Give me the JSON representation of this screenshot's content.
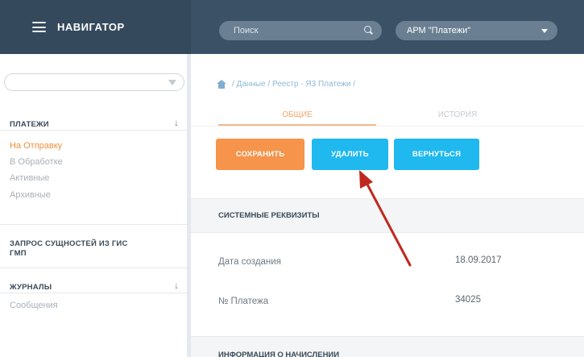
{
  "header": {
    "nav_title": "НАВИГАТОР",
    "search_placeholder": "Поиск",
    "arm_select": "АРМ \"Платежи\""
  },
  "sidebar": {
    "filter_placeholder": "",
    "sections": [
      {
        "title": "ПЛАТЕЖИ",
        "items": [
          "На Отправку",
          "В Обработке",
          "Активные",
          "Архивные"
        ],
        "active_item": "На Отправку"
      },
      {
        "title_line1": "ЗАПРОС СУЩНОСТЕЙ ИЗ ГИС",
        "title_line2": "ГМП"
      },
      {
        "title": "ЖУРНАЛЫ",
        "items": [
          "Сообщения"
        ]
      }
    ],
    "expand_arrow": "↓"
  },
  "main": {
    "breadcrumb": "/ Данные / Реестр - Я3 Платежи /",
    "tabs": {
      "general": "ОБЩИЕ",
      "history": "ИСТОРИЯ"
    },
    "buttons": {
      "save": "СОХРАНИТЬ",
      "delete": "УДАЛИТЬ",
      "back": "ВЕРНУТЬСЯ"
    },
    "section_title": "СИСТЕМНЫЕ РЕКВИЗИТЫ",
    "fields": [
      {
        "label": "Дата создания",
        "value": "18.09.2017"
      },
      {
        "label": "№ Платежа",
        "value": "34025"
      }
    ],
    "bottom_section_title": "ИНФОРМАЦИЯ О НАЧИСЛЕНИИ"
  },
  "colors": {
    "header_bg": "#3a5166",
    "accent_orange": "#f5944a",
    "accent_blue": "#1fb8ef",
    "annotation_arrow": "#c0281d"
  }
}
